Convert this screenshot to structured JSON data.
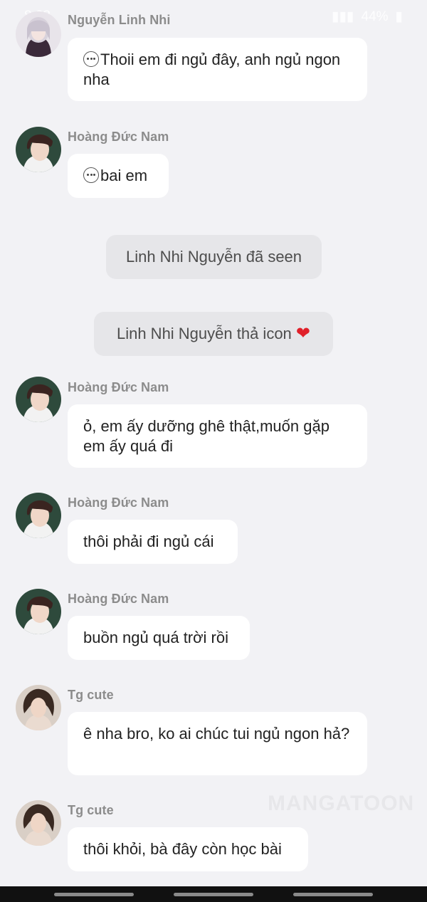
{
  "status_bar": {
    "time": "8:28",
    "battery": "44%"
  },
  "messages": [
    {
      "sender": "Nguyễn Linh Nhi",
      "text": "Thoii em đi ngủ đây, anh ngủ ngon nha",
      "typing_icon": true
    },
    {
      "sender": "Hoàng Đức Nam",
      "text": "bai em",
      "typing_icon": true
    },
    {
      "sender": "Hoàng Đức Nam",
      "text": "ỏ, em ấy dưỡng ghê thật,muốn gặp em ấy quá đi"
    },
    {
      "sender": "Hoàng Đức Nam",
      "text": "thôi phải đi ngủ cái"
    },
    {
      "sender": "Hoàng Đức Nam",
      "text": "buồn ngủ quá trời rồi"
    },
    {
      "sender": "Tg cute",
      "text": "ê nha bro, ko ai chúc tui ngủ ngon hả?"
    },
    {
      "sender": "Tg cute",
      "text": "thôi khỏi, bà đây còn học bài"
    }
  ],
  "system_messages": [
    {
      "text": "Linh Nhi Nguyễn đã seen"
    },
    {
      "text": "Linh Nhi Nguyễn thả icon",
      "icon": "heart-icon"
    }
  ],
  "watermark": "MANGATOON",
  "colors": {
    "background": "#f2f2f5",
    "bubble": "#ffffff",
    "system_bubble": "#e6e6e9",
    "heart": "#e0202a"
  }
}
